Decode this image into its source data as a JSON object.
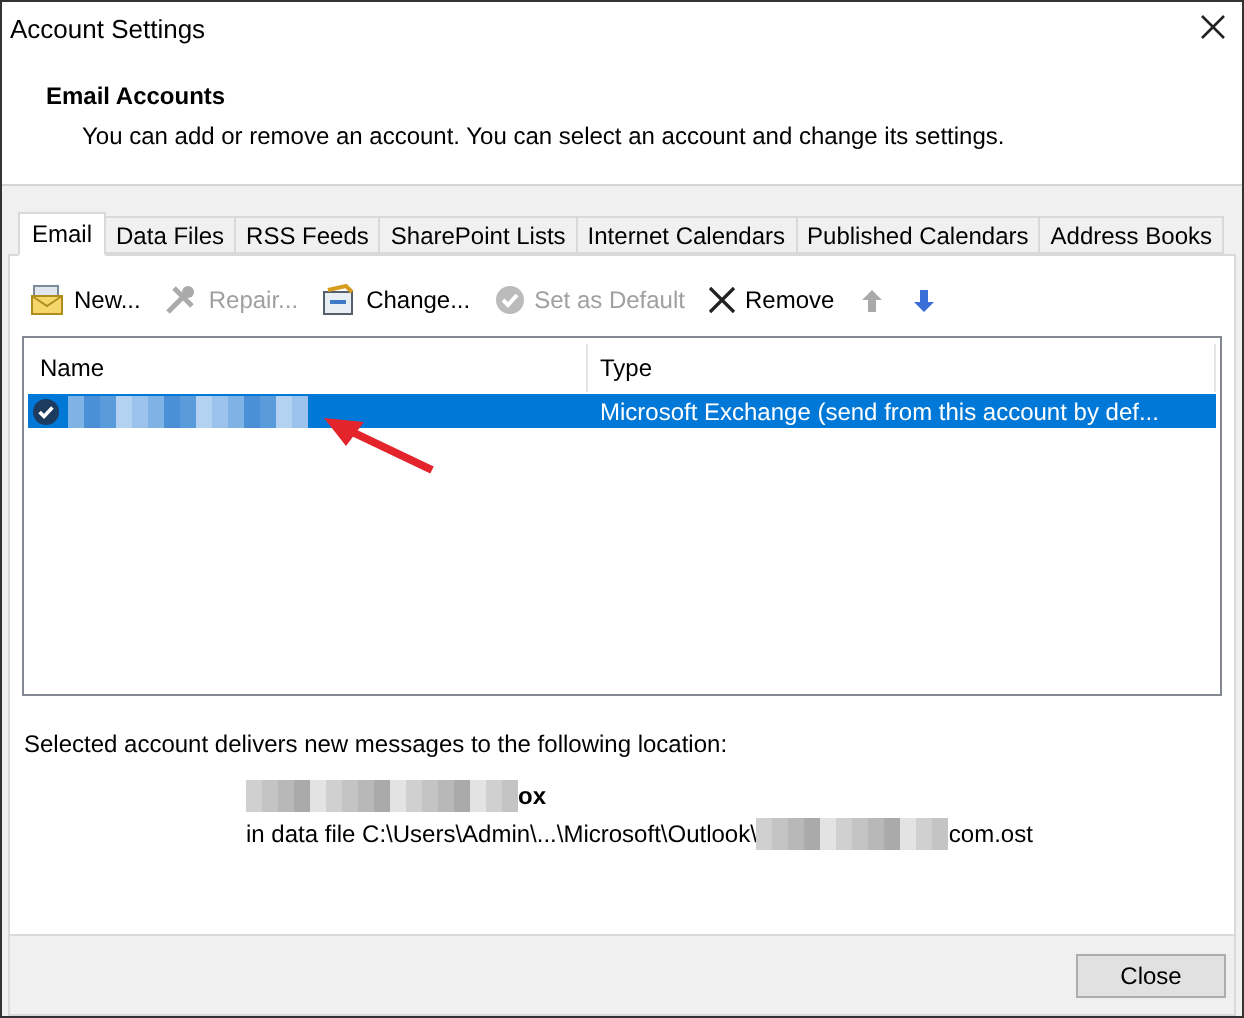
{
  "window": {
    "title": "Account Settings"
  },
  "header": {
    "title": "Email Accounts",
    "description": "You can add or remove an account. You can select an account and change its settings."
  },
  "tabs": [
    {
      "label": "Email",
      "selected": true
    },
    {
      "label": "Data Files",
      "selected": false
    },
    {
      "label": "RSS Feeds",
      "selected": false
    },
    {
      "label": "SharePoint Lists",
      "selected": false
    },
    {
      "label": "Internet Calendars",
      "selected": false
    },
    {
      "label": "Published Calendars",
      "selected": false
    },
    {
      "label": "Address Books",
      "selected": false
    }
  ],
  "toolbar": [
    {
      "kind": "new",
      "label": "New...",
      "disabled": false
    },
    {
      "kind": "repair",
      "label": "Repair...",
      "disabled": true
    },
    {
      "kind": "change",
      "label": "Change...",
      "disabled": false
    },
    {
      "kind": "default",
      "label": "Set as Default",
      "disabled": true
    },
    {
      "kind": "remove",
      "label": "Remove",
      "disabled": false
    },
    {
      "kind": "up",
      "disabled": true
    },
    {
      "kind": "down",
      "disabled": false
    }
  ],
  "accounts": {
    "columns": [
      "Name",
      "Type"
    ],
    "rows": [
      {
        "type": "Microsoft Exchange (send from this account by def...",
        "selected": true,
        "default": true
      }
    ]
  },
  "location": {
    "intro": "Selected account delivers new messages to the following location:",
    "mailbox_suffix": "ox",
    "path_prefix": "in data file C:\\Users\\Admin\\...\\Microsoft\\Outlook\\",
    "path_suffix": "com.ost"
  },
  "close_button": {
    "label": "Close"
  }
}
